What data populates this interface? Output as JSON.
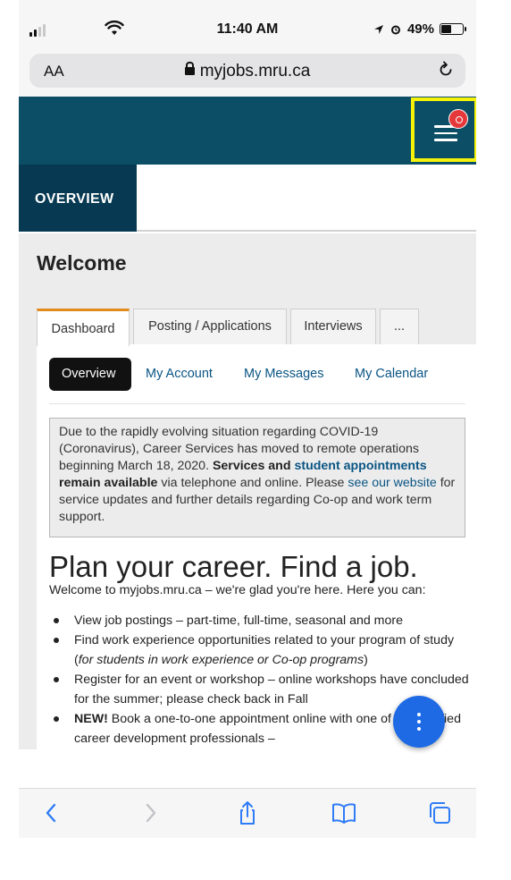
{
  "status_bar": {
    "time": "11:40 AM",
    "battery": "49%"
  },
  "browser": {
    "text_size": "AA",
    "url": "myjobs.mru.ca"
  },
  "site_nav": {
    "section": "OVERVIEW"
  },
  "page": {
    "title": "Welcome",
    "tabs": [
      {
        "label": "Dashboard",
        "active": true
      },
      {
        "label": "Posting / Applications",
        "active": false
      },
      {
        "label": "Interviews",
        "active": false
      },
      {
        "label": "...",
        "active": false
      }
    ],
    "subnav": [
      {
        "label": "Overview",
        "active": true
      },
      {
        "label": "My Account",
        "active": false
      },
      {
        "label": "My Messages",
        "active": false
      },
      {
        "label": "My Calendar",
        "active": false
      }
    ],
    "notice": {
      "text_1": "Due to the rapidly evolving situation regarding COVID-19 (Coronavirus), Career Services has moved to remote operations beginning March 18, 2020. ",
      "bold_1": "Services and ",
      "link_1": "student appointments",
      "bold_2": " remain available",
      "text_2": " via telephone and online. Please ",
      "link_2": "see our website",
      "text_3": " for service updates and further details regarding Co-op and work term support."
    },
    "headline": "Plan your career. Find a job.",
    "intro": "Welcome to myjobs.mru.ca – we're glad you're here. Here you can:",
    "bullets": {
      "b1": "View job postings – part-time, full-time, seasonal and more",
      "b2_text": "Find work experience opportunities related to your program of study (",
      "b2_italic": "for students in work experience or Co-op programs",
      "b2_end": ")",
      "b3": "Register for an event or workshop – online workshops have concluded for the summer; please check back in Fall",
      "b4_bold": "NEW!",
      "b4_text": " Book a one-to-one appointment online with one of our certified career development professionals –"
    }
  },
  "colors": {
    "header_teal": "#0c4e65",
    "overview_tab": "#073a52",
    "highlight_box": "#f5f20a",
    "active_tab_accent": "#e38a1c",
    "link": "#0a5584",
    "fab": "#1e6ae5",
    "ios_blue": "#2f7cf6",
    "notification_badge": "#e5383b"
  },
  "icons": {
    "menu": "hamburger-icon",
    "notification": "notification-badge-icon",
    "fab": "more-vertical-icon",
    "toolbar": [
      "back-icon",
      "forward-icon",
      "share-icon",
      "bookmarks-icon",
      "tabs-icon"
    ]
  }
}
